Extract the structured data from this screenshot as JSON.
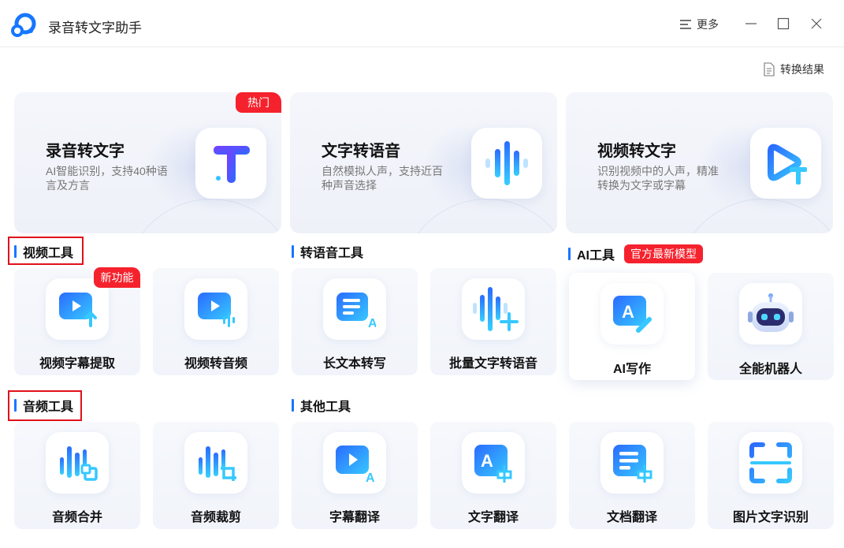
{
  "app": {
    "title": "录音转文字助手"
  },
  "titlebar": {
    "more_label": "更多"
  },
  "result_link": {
    "label": "转换结果"
  },
  "hero_cards": [
    {
      "title": "录音转文字",
      "desc": "AI智能识别，支持40种语言及方言",
      "badge": "热门",
      "icon": "text-t-icon"
    },
    {
      "title": "文字转语音",
      "desc": "自然模拟人声，支持近百种声音选择",
      "icon": "audio-wave-icon"
    },
    {
      "title": "视频转文字",
      "desc": "识别视频中的人声，精准转换为文字或字幕",
      "icon": "video-text-icon"
    }
  ],
  "sections": {
    "video": "视频工具",
    "tts": "转语音工具",
    "ai": "AI工具",
    "ai_badge": "官方最新模型",
    "audio": "音频工具",
    "other": "其他工具"
  },
  "tools": {
    "video_subtitle": {
      "label": "视频字幕提取",
      "badge": "新功能"
    },
    "video_to_audio": {
      "label": "视频转音频"
    },
    "long_text": {
      "label": "长文本转写"
    },
    "batch_tts": {
      "label": "批量文字转语音"
    },
    "ai_writing": {
      "label": "AI写作"
    },
    "robot": {
      "label": "全能机器人"
    },
    "audio_merge": {
      "label": "音频合并"
    },
    "audio_cut": {
      "label": "音频裁剪"
    },
    "subtitle_translate": {
      "label": "字幕翻译"
    },
    "text_translate": {
      "label": "文字翻译"
    },
    "doc_translate": {
      "label": "文档翻译"
    },
    "ocr": {
      "label": "图片文字识别"
    }
  },
  "colors": {
    "accent": "#1677ff",
    "badge_red": "#f5222d",
    "highlight_box": "#e0101a"
  }
}
